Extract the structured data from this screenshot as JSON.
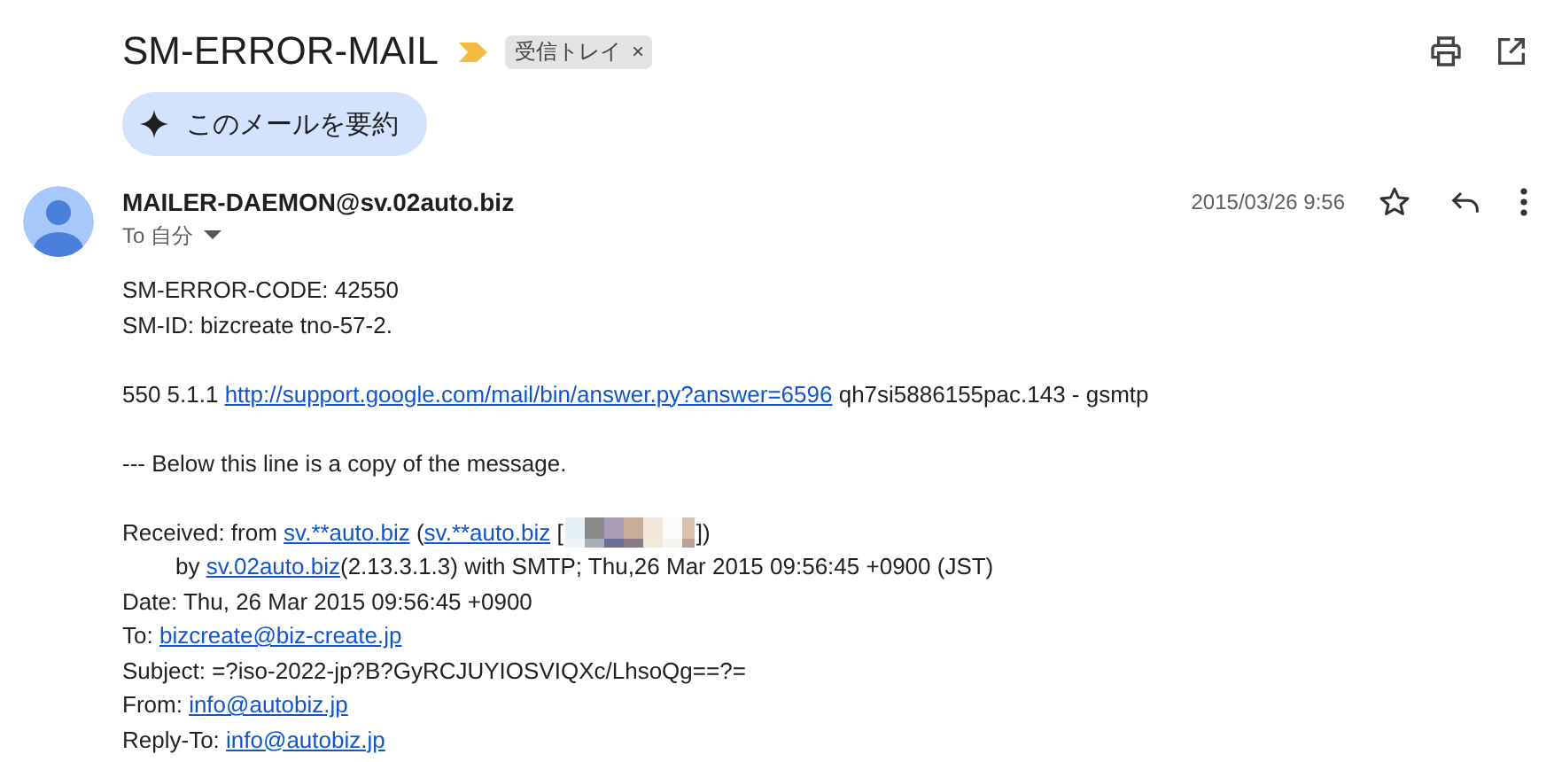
{
  "subject": "SM-ERROR-MAIL",
  "label": {
    "text": "受信トレイ",
    "close": "×"
  },
  "summarize_button": "このメールを要約",
  "sender": "MAILER-DAEMON@sv.02auto.biz",
  "recipient": "To 自分",
  "date": "2015/03/26 9:56",
  "starred": false,
  "paragraphs": [
    [
      {
        "indented": false,
        "segments": [
          {
            "kind": "text",
            "text": "SM-ERROR-CODE: 42550"
          }
        ]
      },
      {
        "indented": false,
        "segments": [
          {
            "kind": "text",
            "text": "SM-ID: bizcreate tno-57-2."
          }
        ]
      }
    ],
    [
      {
        "indented": false,
        "segments": [
          {
            "kind": "text",
            "text": "550 5.1.1 "
          },
          {
            "kind": "link",
            "text": "http://support.google.com/mail/bin/answer.py?answer=6596"
          },
          {
            "kind": "text",
            "text": " qh7si5886155pac.143 - gsmtp"
          }
        ]
      }
    ],
    [
      {
        "indented": false,
        "segments": [
          {
            "kind": "text",
            "text": "--- Below this line is a copy of the message."
          }
        ]
      }
    ],
    [
      {
        "indented": false,
        "segments": [
          {
            "kind": "text",
            "text": "Received: from "
          },
          {
            "kind": "link",
            "text": "sv.**auto.biz"
          },
          {
            "kind": "text",
            "text": " ("
          },
          {
            "kind": "link",
            "text": "sv.**auto.biz"
          },
          {
            "kind": "text",
            "text": " ["
          },
          {
            "kind": "redacted"
          },
          {
            "kind": "text",
            "text": "])"
          }
        ]
      },
      {
        "indented": true,
        "segments": [
          {
            "kind": "text",
            "text": "by "
          },
          {
            "kind": "link",
            "text": "sv.02auto.biz"
          },
          {
            "kind": "text",
            "text": "(2.13.3.1.3) with SMTP; Thu,26 Mar 2015 09:56:45 +0900 (JST)"
          }
        ]
      },
      {
        "indented": false,
        "segments": [
          {
            "kind": "text",
            "text": "Date: Thu, 26 Mar 2015 09:56:45 +0900"
          }
        ]
      },
      {
        "indented": false,
        "segments": [
          {
            "kind": "text",
            "text": "To: "
          },
          {
            "kind": "link",
            "text": "bizcreate@biz-create.jp"
          }
        ]
      },
      {
        "indented": false,
        "segments": [
          {
            "kind": "text",
            "text": "Subject: =?iso-2022-jp?B?GyRCJUYIOSVIQXc/LhsoQg==?="
          }
        ]
      },
      {
        "indented": false,
        "segments": [
          {
            "kind": "text",
            "text": "From: "
          },
          {
            "kind": "link",
            "text": "info@autobiz.jp"
          }
        ]
      },
      {
        "indented": false,
        "segments": [
          {
            "kind": "text",
            "text": "Reply-To: "
          },
          {
            "kind": "link",
            "text": "info@autobiz.jp"
          }
        ]
      }
    ]
  ]
}
